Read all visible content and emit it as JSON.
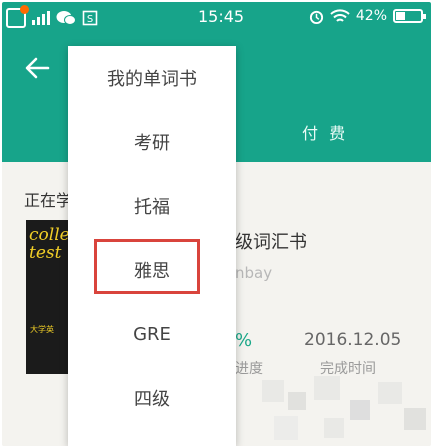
{
  "status_bar": {
    "time": "15:45",
    "battery_percent": "42%",
    "battery_level": 0.42,
    "icons": [
      "app-badge-icon",
      "signal-icon",
      "wechat-icon",
      "sim-icon",
      "alarm-icon",
      "wifi-icon",
      "battery-icon"
    ]
  },
  "header": {
    "back_icon": "back-arrow-icon",
    "tab_paid": "付 费",
    "accent_color": "#17a48a"
  },
  "menu": {
    "items": [
      "我的单词书",
      "考研",
      "托福",
      "雅思",
      "GRE",
      "四级"
    ],
    "highlighted": "雅思",
    "highlight_color": "#d9443c"
  },
  "content": {
    "section_title": "正在学",
    "book": {
      "cover_text": "college test",
      "cover_caption": "大学英",
      "title": "级词汇书",
      "publisher": "nbay"
    },
    "progress": {
      "value": "%",
      "label": "进度"
    },
    "finish": {
      "date": "2016.12.05",
      "label": "完成时间"
    }
  }
}
